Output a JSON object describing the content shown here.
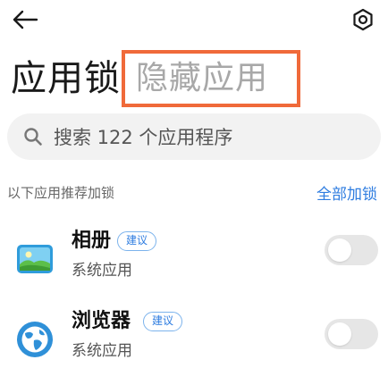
{
  "header": {
    "back_icon": "back-arrow-icon",
    "settings_icon": "settings-hexagon-icon"
  },
  "title": {
    "main": "应用锁",
    "tab_hidden": "隐藏应用",
    "highlight_color": "#f06a3a"
  },
  "search": {
    "icon": "search-icon",
    "placeholder": "搜索 122 个应用程序"
  },
  "section": {
    "label": "以下应用推荐加锁",
    "action": "全部加锁",
    "accent_color": "#2f7de0"
  },
  "apps": [
    {
      "name": "相册",
      "badge": "建议",
      "subtitle": "系统应用",
      "icon": "gallery-icon",
      "locked": false
    },
    {
      "name": "浏览器",
      "badge": "建议",
      "subtitle": "系统应用",
      "icon": "browser-globe-icon",
      "locked": false
    }
  ]
}
